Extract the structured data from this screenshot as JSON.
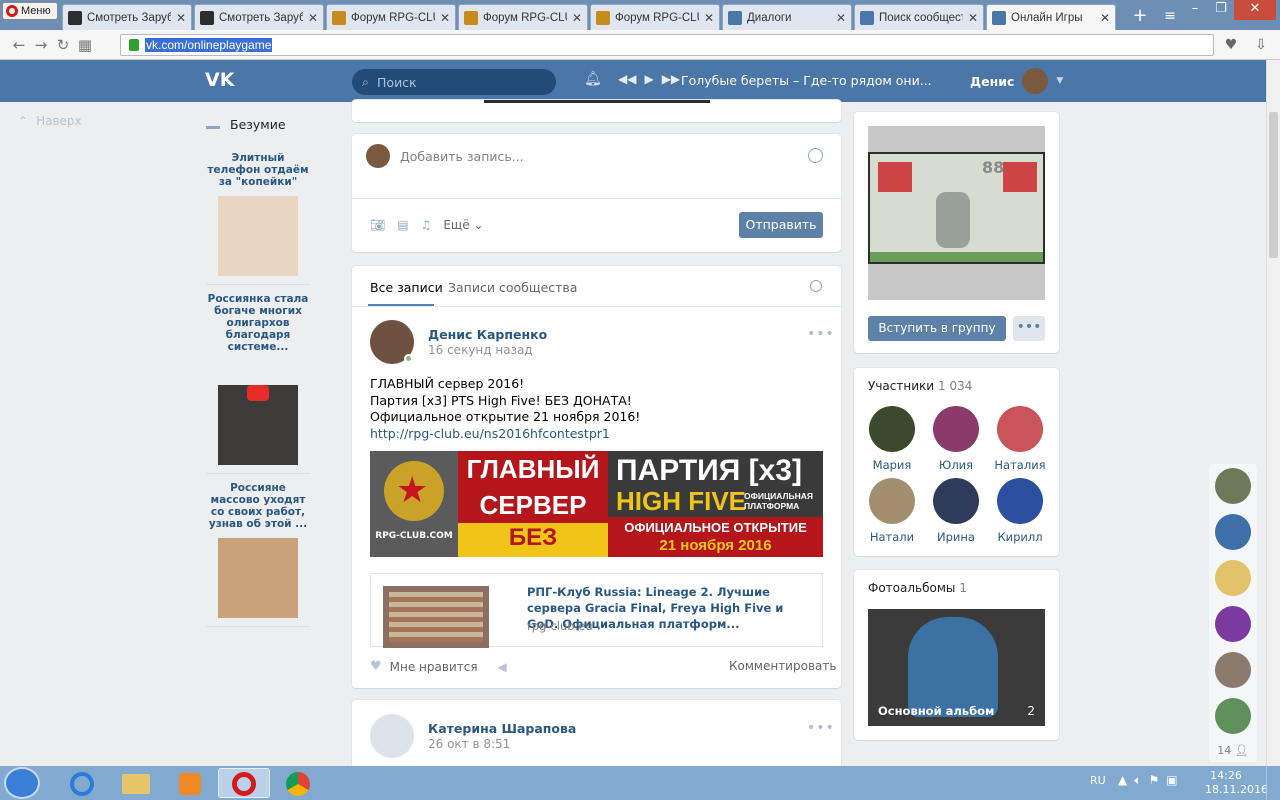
{
  "browser": {
    "menu_label": "Меню",
    "tabs": [
      {
        "label": "Смотреть Зарубе",
        "icon": "torrent-icon",
        "active": false
      },
      {
        "label": "Смотреть Зарубе",
        "icon": "torrent-icon",
        "active": false
      },
      {
        "label": "Форум RPG-CLUB",
        "icon": "shield-icon",
        "active": false
      },
      {
        "label": "Форум RPG-CLUB",
        "icon": "shield-icon",
        "active": false
      },
      {
        "label": "Форум RPG-CLUB",
        "icon": "shield-icon",
        "active": false
      },
      {
        "label": "Диалоги",
        "icon": "chat-icon",
        "active": false
      },
      {
        "label": "Поиск сообществ",
        "icon": "vk-icon",
        "active": false
      },
      {
        "label": "Онлайн Игры",
        "icon": "vk-icon",
        "active": true
      }
    ],
    "url": "vk.com/onlineplaygame"
  },
  "vk": {
    "logo": "VK",
    "search_placeholder": "Поиск",
    "now_playing": "Голубые береты – Где-то рядом они...",
    "user_name": "Денис"
  },
  "left": {
    "up_label": "Наверх",
    "menu_item": "Безумие",
    "ads": [
      {
        "title": "Элитный телефон отдаём за \"копейки\"",
        "img": "#e8d6c2"
      },
      {
        "title": "Россиянка стала богаче многих олигархов благодаря системе...",
        "img": "#3e3c3a"
      },
      {
        "title": "Россияне массово уходят со своих работ, узнав об этой ...",
        "img": "#c9a27c"
      }
    ]
  },
  "composer": {
    "placeholder": "Добавить запись...",
    "more_label": "Ещё",
    "send_label": "Отправить"
  },
  "feed": {
    "tab_all": "Все записи",
    "tab_community": "Записи сообщества",
    "post": {
      "author": "Денис Карпенко",
      "time": "16 секунд назад",
      "lines": [
        "ГЛАВНЫЙ сервер 2016!",
        "Партия [x3] PTS High Five! БЕЗ ДОНАТА!",
        "Официальное открытие 21 ноября 2016!"
      ],
      "link": "http://rpg-club.eu/ns2016hfcontestpr1",
      "banner": {
        "logo": "RPG-CLUB.COM",
        "red_line1": "ГЛАВНЫЙ",
        "red_line2": "СЕРВЕР",
        "red_line3": "БЕЗ ДОНАТА",
        "dark_line1": "ПАРТИЯ [x3]",
        "dark_line2": "HIGH FIVE",
        "dark_side": "ОФИЦИАЛЬНАЯ ПЛАТФОРМА",
        "dark_line3": "ОФИЦИАЛЬНОЕ ОТКРЫТИЕ",
        "dark_line4": "21 ноября 2016"
      },
      "card_title": "РПГ-Клуб Russia: Lineage 2. Лучшие сервера Gracia Final, Freya High Five и GoD. Официальная платформ...",
      "card_domain": "rpg-club.eu",
      "like_label": "Мне нравится",
      "comment_label": "Комментировать"
    },
    "post2": {
      "author": "Катерина Шарапова",
      "time": "26 окт в 8:51"
    }
  },
  "group": {
    "join_label": "Вступить в группу",
    "game_score": "88"
  },
  "members": {
    "title": "Участники",
    "count": "1 034",
    "list": [
      {
        "name": "Мария",
        "color": "#3b4a2c"
      },
      {
        "name": "Юлия",
        "color": "#8a3b6a"
      },
      {
        "name": "Наталия",
        "color": "#c9545a"
      },
      {
        "name": "Натали",
        "color": "#a38f6f"
      },
      {
        "name": "Ирина",
        "color": "#2f3b5a"
      },
      {
        "name": "Кирилл",
        "color": "#2d4fa0"
      }
    ]
  },
  "albums": {
    "title": "Фотоальбомы",
    "count": "1",
    "album_label": "Основной альбом",
    "album_count": "2"
  },
  "friends": {
    "count": "14",
    "avatars": [
      "#6b7b5a",
      "#3f6fa8",
      "#e2c36a",
      "#7a3aa0",
      "#8c7a6e",
      "#5f8f5a"
    ]
  },
  "taskbar": {
    "lang": "RU",
    "time": "14:26",
    "date": "18.11.2016"
  }
}
